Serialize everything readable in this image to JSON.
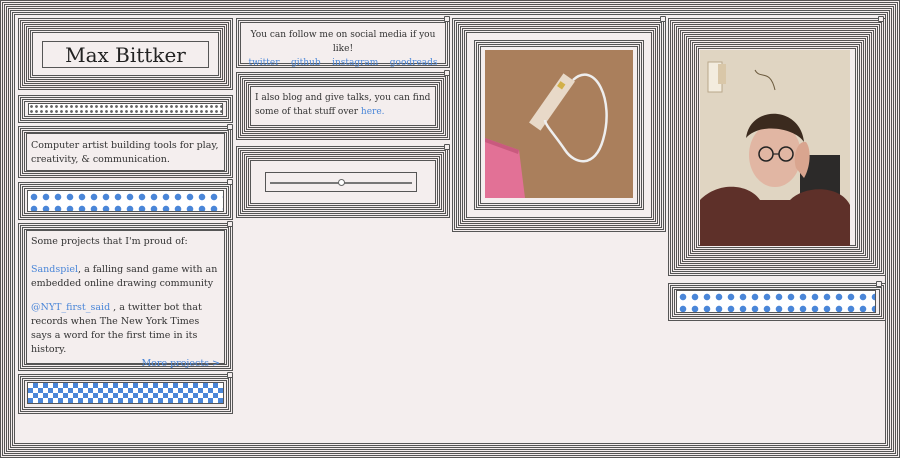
{
  "profile": {
    "name": "Max Bittker",
    "tagline": "Computer artist building tools for play, creativity, & communication."
  },
  "social": {
    "intro": "You can follow me on social media if you like!",
    "links": [
      "twitter",
      "github",
      "instagram",
      "goodreads"
    ]
  },
  "blog": {
    "text": "I also blog and give talks, you can find some of that stuff over ",
    "link": "here."
  },
  "projects": {
    "intro": "Some projects that I'm proud of:",
    "items": [
      {
        "name": "Sandspiel",
        "desc": ", a falling sand game with an embedded online drawing community"
      },
      {
        "name": "@NYT_first_said",
        "desc": " , a twitter bot that records when The New York Times says a word for the first time in its history."
      }
    ],
    "more": "More projects >"
  },
  "slider": {
    "value": 0.5
  },
  "colors": {
    "background": "#f4eeee",
    "link": "#4a86d8",
    "stripe": "#555555"
  },
  "photos": {
    "object": "cable-on-cardboard-photo",
    "portrait": "portrait-photo"
  }
}
